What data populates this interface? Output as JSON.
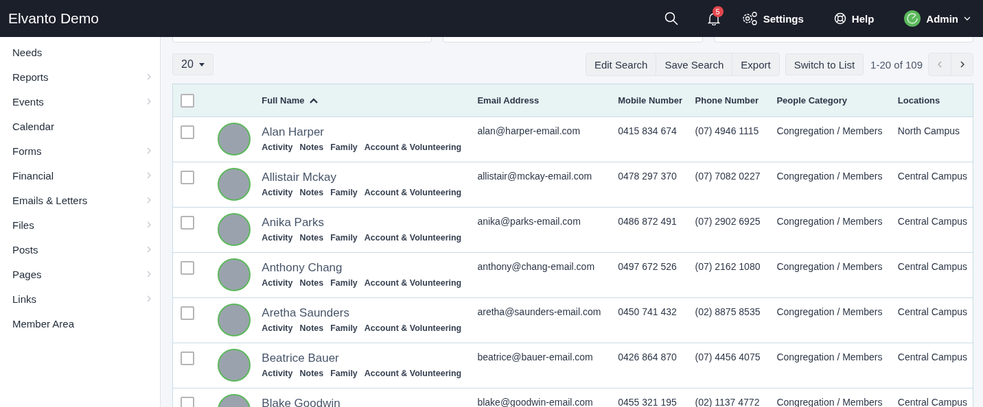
{
  "topbar": {
    "title": "Elvanto Demo",
    "notification_count": "5",
    "settings_label": "Settings",
    "help_label": "Help",
    "user_label": "Admin"
  },
  "sidebar": {
    "items": [
      {
        "label": "Needs",
        "has_submenu": false
      },
      {
        "label": "Reports",
        "has_submenu": true
      },
      {
        "label": "Events",
        "has_submenu": true
      },
      {
        "label": "Calendar",
        "has_submenu": false
      },
      {
        "label": "Forms",
        "has_submenu": true
      },
      {
        "label": "Financial",
        "has_submenu": true
      },
      {
        "label": "Emails & Letters",
        "has_submenu": true
      },
      {
        "label": "Files",
        "has_submenu": true
      },
      {
        "label": "Posts",
        "has_submenu": true
      },
      {
        "label": "Pages",
        "has_submenu": true
      },
      {
        "label": "Links",
        "has_submenu": true
      },
      {
        "label": "Member Area",
        "has_submenu": false
      }
    ]
  },
  "toolbar": {
    "page_size": "20",
    "buttons": [
      "Edit Search",
      "Save Search",
      "Export"
    ],
    "switch_button": "Switch to List",
    "range": "1-20 of 109"
  },
  "table": {
    "all_checked": false,
    "columns": [
      {
        "label": "Full Name",
        "sorted": true
      },
      {
        "label": "Email Address",
        "sorted": false
      },
      {
        "label": "Mobile Number",
        "sorted": false
      },
      {
        "label": "Phone Number",
        "sorted": false
      },
      {
        "label": "People Category",
        "sorted": false
      },
      {
        "label": "Locations",
        "sorted": false
      }
    ],
    "rows": [
      {
        "checked": false,
        "name": "Alan Harper",
        "links": [
          "Activity",
          "Notes",
          "Family",
          "Account & Volunteering"
        ],
        "email": "alan@harper-email.com",
        "mobile": "0415 834 674",
        "phone": "(07) 4946 1115",
        "category": "Congregation / Members",
        "location": "North Campus"
      },
      {
        "checked": false,
        "name": "Allistair Mckay",
        "links": [
          "Activity",
          "Notes",
          "Family",
          "Account & Volunteering"
        ],
        "email": "allistair@mckay-email.com",
        "mobile": "0478 297 370",
        "phone": "(07) 7082 0227",
        "category": "Congregation / Members",
        "location": "Central Campus"
      },
      {
        "checked": false,
        "name": "Anika Parks",
        "links": [
          "Activity",
          "Notes",
          "Family",
          "Account & Volunteering"
        ],
        "email": "anika@parks-email.com",
        "mobile": "0486 872 491",
        "phone": "(07) 2902 6925",
        "category": "Congregation / Members",
        "location": "Central Campus"
      },
      {
        "checked": false,
        "name": "Anthony Chang",
        "links": [
          "Activity",
          "Notes",
          "Family",
          "Account & Volunteering"
        ],
        "email": "anthony@chang-email.com",
        "mobile": "0497 672 526",
        "phone": "(07) 2162 1080",
        "category": "Congregation / Members",
        "location": "Central Campus"
      },
      {
        "checked": false,
        "name": "Aretha Saunders",
        "links": [
          "Activity",
          "Notes",
          "Family",
          "Account & Volunteering"
        ],
        "email": "aretha@saunders-email.com",
        "mobile": "0450 741 432",
        "phone": "(02) 8875 8535",
        "category": "Congregation / Members",
        "location": "Central Campus"
      },
      {
        "checked": false,
        "name": "Beatrice Bauer",
        "links": [
          "Activity",
          "Notes",
          "Family",
          "Account & Volunteering"
        ],
        "email": "beatrice@bauer-email.com",
        "mobile": "0426 864 870",
        "phone": "(07) 4456 4075",
        "category": "Congregation / Members",
        "location": "Central Campus"
      },
      {
        "checked": false,
        "name": "Blake Goodwin",
        "links": [],
        "email": "blake@goodwin-email.com",
        "mobile": "0455 321 195",
        "phone": "(02) 1137 4772",
        "category": "Congregation / Members",
        "location": "Central Campus"
      }
    ]
  }
}
